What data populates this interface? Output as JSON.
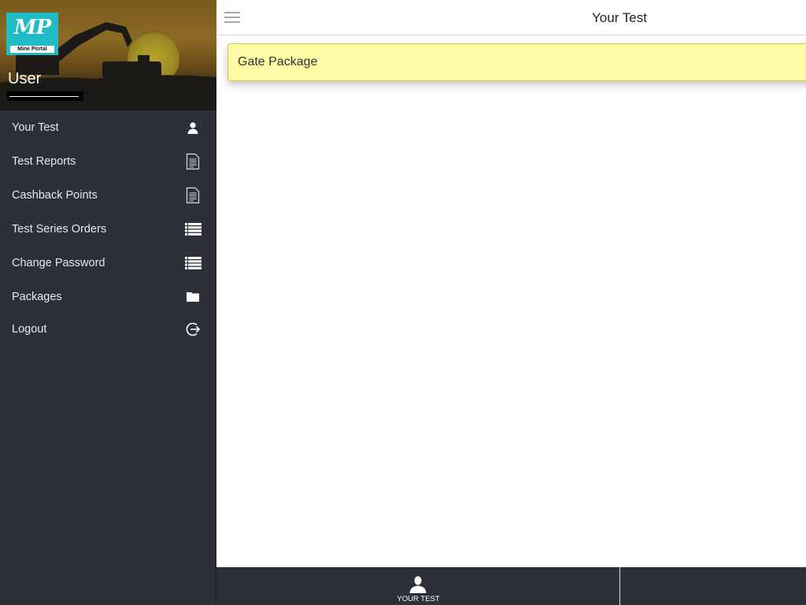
{
  "sidebar": {
    "logo": {
      "mark": "MP",
      "subtitle": "Mine Portal"
    },
    "user": {
      "name": "User"
    },
    "items": [
      {
        "label": "Your Test",
        "icon": "user-icon"
      },
      {
        "label": "Test Reports",
        "icon": "document-icon"
      },
      {
        "label": "Cashback Points",
        "icon": "document-icon"
      },
      {
        "label": "Test Series Orders",
        "icon": "list-icon"
      },
      {
        "label": "Change Password",
        "icon": "list-icon"
      },
      {
        "label": "Packages",
        "icon": "folder-icon"
      },
      {
        "label": "Logout",
        "icon": "logout-icon"
      }
    ]
  },
  "header": {
    "title": "Your Test",
    "menu_icon": "hamburger-icon"
  },
  "main": {
    "cards": [
      {
        "label": "Gate Package"
      }
    ]
  },
  "bottom_nav": {
    "tabs": [
      {
        "label": "YOUR TEST",
        "icon": "user-icon"
      }
    ]
  },
  "colors": {
    "sidebar_bg": "#2d3038",
    "card_bg": "#fefba7",
    "card_border": "#d5c840",
    "logo_bg": "#1fbcc5"
  }
}
